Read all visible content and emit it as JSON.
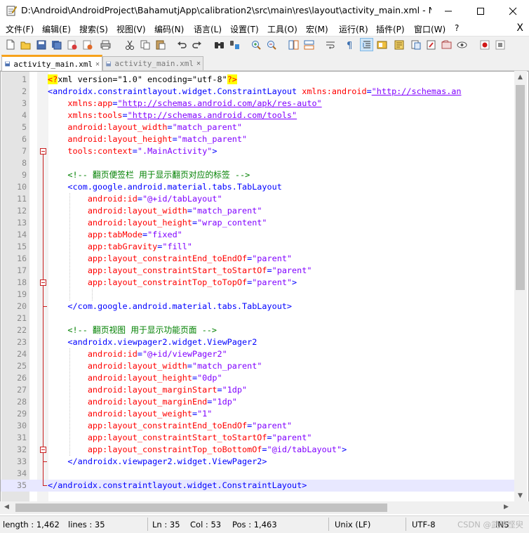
{
  "window": {
    "title": "D:\\Android\\AndroidProject\\BahamutjApp\\calibration2\\src\\main\\res\\layout\\activity_main.xml - Note..."
  },
  "menu": {
    "items": [
      "文件(F)",
      "编辑(E)",
      "搜索(S)",
      "视图(V)",
      "编码(N)",
      "语言(L)",
      "设置(T)",
      "工具(O)",
      "宏(M)",
      "运行(R)",
      "插件(P)",
      "窗口(W)",
      "?"
    ],
    "close_glyph": "X"
  },
  "toolbar": {
    "icons": [
      "new-file-icon",
      "open-file-icon",
      "save-icon",
      "save-all-icon",
      "close-icon",
      "close-all-icon",
      "print-icon",
      "cut-icon",
      "copy-icon",
      "paste-icon",
      "undo-icon",
      "redo-icon",
      "find-icon",
      "replace-icon",
      "zoom-in-icon",
      "zoom-out-icon",
      "sync-vertical-icon",
      "sync-horizontal-icon",
      "word-wrap-icon",
      "show-all-chars-icon",
      "indent-guide-icon",
      "udl-icon",
      "doc-map-icon",
      "function-list-icon",
      "folder-workspace-icon",
      "monitor-icon",
      "record-macro-icon",
      "stop-record-icon"
    ]
  },
  "tabs": [
    {
      "label": "activity_main.xml",
      "active": true,
      "close": "✕"
    },
    {
      "label": "activity_main.xml",
      "active": false,
      "close": "✕"
    }
  ],
  "editor": {
    "current_line": 35,
    "lines": [
      [
        [
          "hl",
          "<?"
        ],
        [
          "c-pi",
          "xml version=\"1.0\" encoding=\"utf-8\""
        ],
        [
          "hl",
          "?>"
        ]
      ],
      [
        [
          "tag",
          "<androidx.constraintlayout.widget.ConstraintLayout "
        ],
        [
          "attr",
          "xmlns:android"
        ],
        [
          "tag",
          "="
        ],
        [
          "url",
          "\"http://schemas.an"
        ]
      ],
      [
        [
          "attr",
          "    xmlns:app"
        ],
        [
          "tag",
          "="
        ],
        [
          "url",
          "\"http://schemas.android.com/apk/res-auto\""
        ]
      ],
      [
        [
          "attr",
          "    xmlns:tools"
        ],
        [
          "tag",
          "="
        ],
        [
          "url",
          "\"http://schemas.android.com/tools\""
        ]
      ],
      [
        [
          "attr",
          "    android:layout_width"
        ],
        [
          "tag",
          "="
        ],
        [
          "val",
          "\"match_parent\""
        ]
      ],
      [
        [
          "attr",
          "    android:layout_height"
        ],
        [
          "tag",
          "="
        ],
        [
          "val",
          "\"match_parent\""
        ]
      ],
      [
        [
          "attr",
          "    tools:context"
        ],
        [
          "tag",
          "="
        ],
        [
          "val",
          "\".MainActivity\""
        ],
        [
          "tag",
          ">"
        ]
      ],
      [],
      [
        [
          "cmt",
          "    <!-- 翻页便签栏 用于显示翻页对应的标签 -->"
        ]
      ],
      [
        [
          "tag",
          "    <com.google.android.material.tabs.TabLayout"
        ]
      ],
      [
        [
          "attr",
          "        android:id"
        ],
        [
          "tag",
          "="
        ],
        [
          "val",
          "\"@+id/tabLayout\""
        ]
      ],
      [
        [
          "attr",
          "        android:layout_width"
        ],
        [
          "tag",
          "="
        ],
        [
          "val",
          "\"match_parent\""
        ]
      ],
      [
        [
          "attr",
          "        android:layout_height"
        ],
        [
          "tag",
          "="
        ],
        [
          "val",
          "\"wrap_content\""
        ]
      ],
      [
        [
          "attr",
          "        app:tabMode"
        ],
        [
          "tag",
          "="
        ],
        [
          "val",
          "\"fixed\""
        ]
      ],
      [
        [
          "attr",
          "        app:tabGravity"
        ],
        [
          "tag",
          "="
        ],
        [
          "val",
          "\"fill\""
        ]
      ],
      [
        [
          "attr",
          "        app:layout_constraintEnd_toEndOf"
        ],
        [
          "tag",
          "="
        ],
        [
          "val",
          "\"parent\""
        ]
      ],
      [
        [
          "attr",
          "        app:layout_constraintStart_toStartOf"
        ],
        [
          "tag",
          "="
        ],
        [
          "val",
          "\"parent\""
        ]
      ],
      [
        [
          "attr",
          "        app:layout_constraintTop_toTopOf"
        ],
        [
          "tag",
          "="
        ],
        [
          "val",
          "\"parent\""
        ],
        [
          "tag",
          ">"
        ]
      ],
      [],
      [
        [
          "tag",
          "    </com.google.android.material.tabs.TabLayout>"
        ]
      ],
      [],
      [
        [
          "cmt",
          "    <!-- 翻页视图 用于显示功能页面 -->"
        ]
      ],
      [
        [
          "tag",
          "    <androidx.viewpager2.widget.ViewPager2"
        ]
      ],
      [
        [
          "attr",
          "        android:id"
        ],
        [
          "tag",
          "="
        ],
        [
          "val",
          "\"@+id/viewPager2\""
        ]
      ],
      [
        [
          "attr",
          "        android:layout_width"
        ],
        [
          "tag",
          "="
        ],
        [
          "val",
          "\"match_parent\""
        ]
      ],
      [
        [
          "attr",
          "        android:layout_height"
        ],
        [
          "tag",
          "="
        ],
        [
          "val",
          "\"0dp\""
        ]
      ],
      [
        [
          "attr",
          "        android:layout_marginStart"
        ],
        [
          "tag",
          "="
        ],
        [
          "val",
          "\"1dp\""
        ]
      ],
      [
        [
          "attr",
          "        android:layout_marginEnd"
        ],
        [
          "tag",
          "="
        ],
        [
          "val",
          "\"1dp\""
        ]
      ],
      [
        [
          "attr",
          "        android:layout_weight"
        ],
        [
          "tag",
          "="
        ],
        [
          "val",
          "\"1\""
        ]
      ],
      [
        [
          "attr",
          "        app:layout_constraintEnd_toEndOf"
        ],
        [
          "tag",
          "="
        ],
        [
          "val",
          "\"parent\""
        ]
      ],
      [
        [
          "attr",
          "        app:layout_constraintStart_toStartOf"
        ],
        [
          "tag",
          "="
        ],
        [
          "val",
          "\"parent\""
        ]
      ],
      [
        [
          "attr",
          "        app:layout_constraintTop_toBottomOf"
        ],
        [
          "tag",
          "="
        ],
        [
          "val",
          "\"@id/tabLayout\""
        ],
        [
          "tag",
          ">"
        ]
      ],
      [
        [
          "tag",
          "    </androidx.viewpager2.widget.ViewPager2>"
        ]
      ],
      [],
      [
        [
          "tag",
          "</androidx.constraintlayout.widget.ConstraintLayout>"
        ]
      ]
    ]
  },
  "status": {
    "length": "length : 1,462",
    "lines": "lines : 35",
    "ln": "Ln : 35",
    "col": "Col : 53",
    "pos": "Pos : 1,463",
    "eol": "Unix (LF)",
    "encoding": "UTF-8",
    "mode": "INS",
    "watermark": "CSDN @武陵悭臾"
  }
}
